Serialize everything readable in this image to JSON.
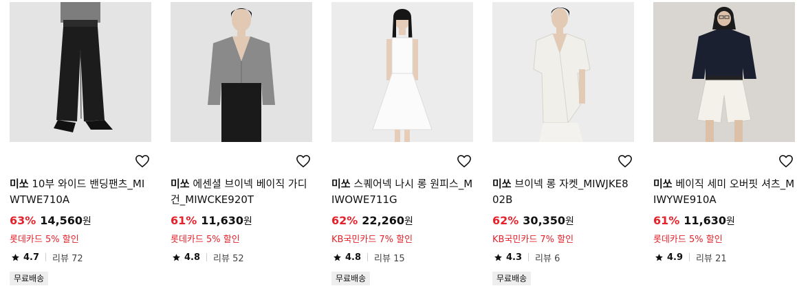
{
  "products": [
    {
      "brand": "미쏘",
      "title": "10부 와이드 밴딩팬츠_MIWTWE710A",
      "discount": "63%",
      "price": "14,560",
      "currency": "원",
      "promo": "롯데카드 5% 할인",
      "rating": "4.7",
      "reviews": "리뷰 72",
      "shipping": "무료배송"
    },
    {
      "brand": "미쏘",
      "title": "에센셜 브이넥 베이직 가디건_MIWCKE920T",
      "discount": "61%",
      "price": "11,630",
      "currency": "원",
      "promo": "롯데카드 5% 할인",
      "rating": "4.8",
      "reviews": "리뷰 52",
      "shipping": ""
    },
    {
      "brand": "미쏘",
      "title": "스퀘어넥 나시 롱 원피스_MIWOWE711G",
      "discount": "62%",
      "price": "22,260",
      "currency": "원",
      "promo": "KB국민카드 7% 할인",
      "rating": "4.8",
      "reviews": "리뷰 15",
      "shipping": "무료배송"
    },
    {
      "brand": "미쏘",
      "title": "브이넥 롱 자켓_MIWJKE802B",
      "discount": "62%",
      "price": "30,350",
      "currency": "원",
      "promo": "KB국민카드 7% 할인",
      "rating": "4.3",
      "reviews": "리뷰 6",
      "shipping": "무료배송"
    },
    {
      "brand": "미쏘",
      "title": "베이직 세미 오버핏 셔츠_MIWYWE910A",
      "discount": "61%",
      "price": "11,630",
      "currency": "원",
      "promo": "롯데카드 5% 할인",
      "rating": "4.9",
      "reviews": "리뷰 21",
      "shipping": ""
    }
  ],
  "icons": {
    "wishlist": "heart-outline-icon",
    "rating": "star-icon"
  },
  "colors": {
    "discount": "#e3222b",
    "promo": "#e3222b",
    "badge_bg": "#eeeeee"
  }
}
